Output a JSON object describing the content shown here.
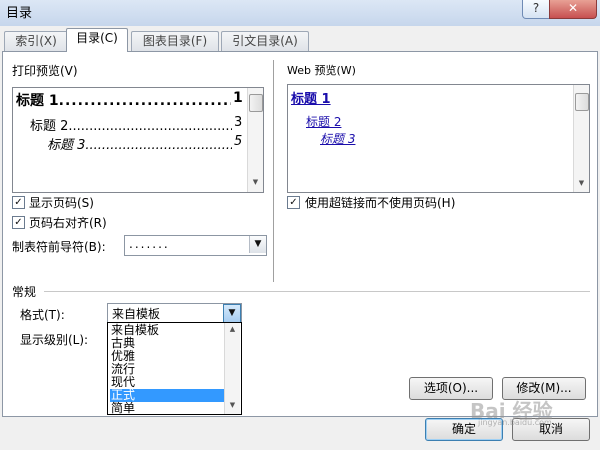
{
  "window": {
    "title": "目录",
    "help_label": "?",
    "close_label": "✕"
  },
  "tabs": [
    {
      "label": "索引(X)"
    },
    {
      "label": "目录(C)"
    },
    {
      "label": "图表目录(F)"
    },
    {
      "label": "引文目录(A)"
    }
  ],
  "print_preview": {
    "label": "打印预览(V)",
    "lines": [
      {
        "text": "标题 1",
        "page": "1"
      },
      {
        "text": "标题 2",
        "page": "3"
      },
      {
        "text": "标题 3",
        "page": "5"
      }
    ]
  },
  "web_preview": {
    "label": "Web 预览(W)",
    "links": [
      "标题 1",
      "标题 2",
      "标题 3"
    ]
  },
  "options": {
    "show_page_numbers": {
      "label": "显示页码(S)",
      "checked": true
    },
    "right_align": {
      "label": "页码右对齐(R)",
      "checked": true
    },
    "tab_leader": {
      "label": "制表符前导符(B):",
      "value": "......."
    },
    "use_hyperlinks": {
      "label": "使用超链接而不使用页码(H)",
      "checked": true
    }
  },
  "general": {
    "label": "常规",
    "format": {
      "label": "格式(T):",
      "value": "来自模板"
    },
    "levels": {
      "label": "显示级别(L):"
    },
    "format_options": [
      "来自模板",
      "古典",
      "优雅",
      "流行",
      "现代",
      "正式",
      "简单"
    ],
    "selected_index": 5
  },
  "buttons": {
    "options": "选项(O)...",
    "modify": "修改(M)...",
    "ok": "确定",
    "cancel": "取消"
  },
  "watermark": {
    "text": "Bai 经验",
    "sub": "jingyan.baidu.com"
  }
}
